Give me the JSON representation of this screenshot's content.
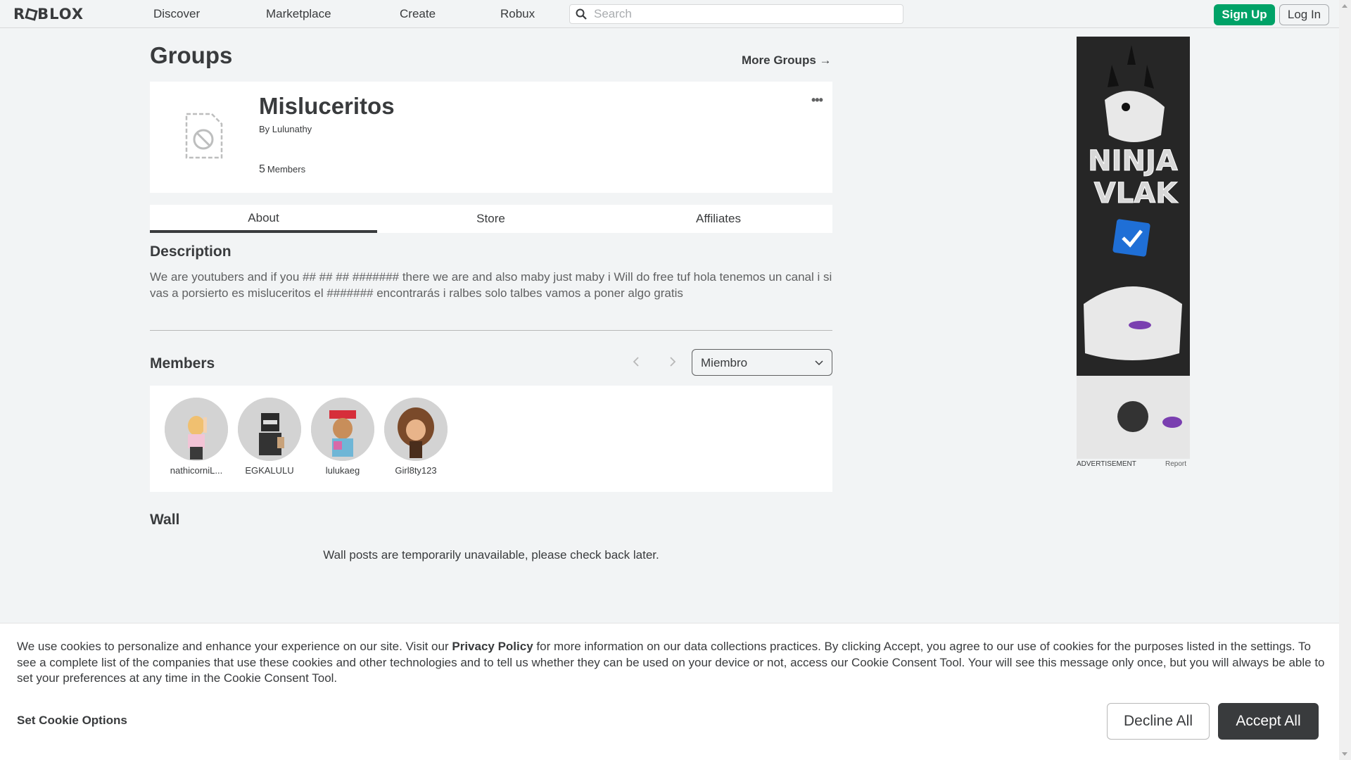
{
  "nav": {
    "logo": "ROBLOX",
    "links": [
      "Discover",
      "Marketplace",
      "Create",
      "Robux"
    ],
    "search_placeholder": "Search",
    "sign_up": "Sign Up",
    "log_in": "Log In"
  },
  "header": {
    "title": "Groups",
    "more_groups": "More Groups →"
  },
  "group": {
    "name": "Misluceritos",
    "by_prefix": "By",
    "owner": "Lulunathy",
    "member_count": "5",
    "member_label": "Members",
    "menu_icon": "more-icon"
  },
  "tabs": [
    {
      "label": "About",
      "active": true
    },
    {
      "label": "Store",
      "active": false
    },
    {
      "label": "Affiliates",
      "active": false
    }
  ],
  "about": {
    "description_heading": "Description",
    "description": "We are youtubers and if you ## ## ## ####### there we are and also maby just maby i Will do free tuf hola tenemos un canal i si vas a porsierto es misluceritos el ####### encontrarás i ralbes solo talbes vamos a poner algo gratis"
  },
  "members": {
    "heading": "Members",
    "role_filter": "Miembro",
    "list": [
      {
        "name": "nathicorniL..."
      },
      {
        "name": "EGKALULU"
      },
      {
        "name": "lulukaeg"
      },
      {
        "name": "Girl8ty123"
      }
    ]
  },
  "wall": {
    "heading": "Wall",
    "message": "Wall posts are temporarily unavailable, please check back later."
  },
  "ad": {
    "label": "ADVERTISEMENT",
    "report": "Report",
    "text_line1": "NINJA",
    "text_line2": "VLAK"
  },
  "cookie": {
    "text_before": "We use cookies to personalize and enhance your experience on our site. Visit our ",
    "link": "Privacy Policy",
    "text_after": " for more information on our data collections practices. By clicking Accept, you agree to our use of cookies for the purposes listed in the settings. To see a complete list of the companies that use these cookies and other technologies and to tell us whether they can be used on your device or not, access our Cookie Consent Tool. Your will see this message only once, but you will always be able to set your preferences at any time in the Cookie Consent Tool.",
    "set_options": "Set Cookie Options",
    "decline": "Decline All",
    "accept": "Accept All"
  },
  "colors": {
    "signup_green": "#00a267",
    "accept_dark": "#393b3d",
    "page_bg": "#f2f4f5"
  }
}
